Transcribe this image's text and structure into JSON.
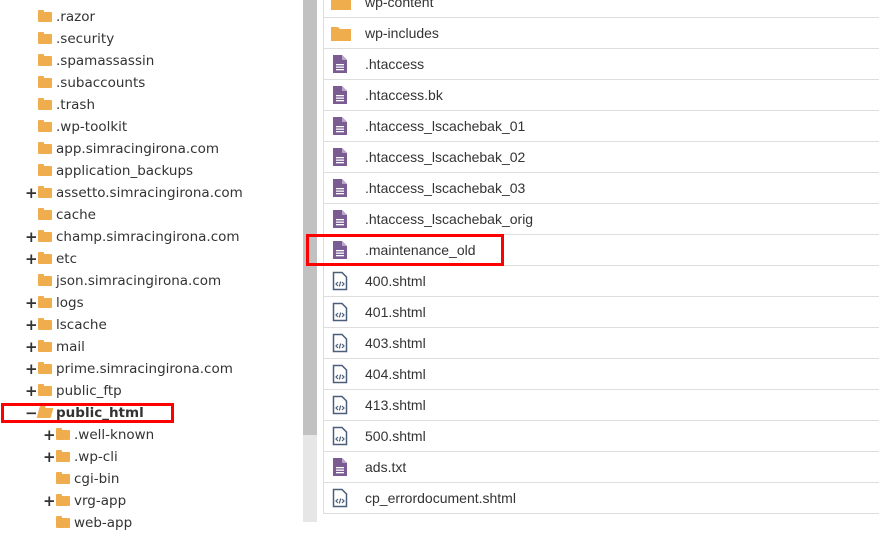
{
  "tree": [
    {
      "label": ".razor",
      "level": 0,
      "toggle": ""
    },
    {
      "label": ".security",
      "level": 0,
      "toggle": ""
    },
    {
      "label": ".spamassassin",
      "level": 0,
      "toggle": ""
    },
    {
      "label": ".subaccounts",
      "level": 0,
      "toggle": ""
    },
    {
      "label": ".trash",
      "level": 0,
      "toggle": ""
    },
    {
      "label": ".wp-toolkit",
      "level": 0,
      "toggle": ""
    },
    {
      "label": "app.simracingirona.com",
      "level": 0,
      "toggle": ""
    },
    {
      "label": "application_backups",
      "level": 0,
      "toggle": ""
    },
    {
      "label": "assetto.simracingirona.com",
      "level": 0,
      "toggle": "+"
    },
    {
      "label": "cache",
      "level": 0,
      "toggle": ""
    },
    {
      "label": "champ.simracingirona.com",
      "level": 0,
      "toggle": "+"
    },
    {
      "label": "etc",
      "level": 0,
      "toggle": "+"
    },
    {
      "label": "json.simracingirona.com",
      "level": 0,
      "toggle": ""
    },
    {
      "label": "logs",
      "level": 0,
      "toggle": "+"
    },
    {
      "label": "lscache",
      "level": 0,
      "toggle": "+"
    },
    {
      "label": "mail",
      "level": 0,
      "toggle": "+"
    },
    {
      "label": "prime.simracingirona.com",
      "level": 0,
      "toggle": "+"
    },
    {
      "label": "public_ftp",
      "level": 0,
      "toggle": "+"
    },
    {
      "label": "public_html",
      "level": 0,
      "toggle": "−",
      "open": true,
      "selected": true
    },
    {
      "label": ".well-known",
      "level": 1,
      "toggle": "+"
    },
    {
      "label": ".wp-cli",
      "level": 1,
      "toggle": "+"
    },
    {
      "label": "cgi-bin",
      "level": 1,
      "toggle": ""
    },
    {
      "label": "vrg-app",
      "level": 1,
      "toggle": "+"
    },
    {
      "label": "web-app",
      "level": 1,
      "toggle": ""
    }
  ],
  "files": [
    {
      "name": "wp-content",
      "type": "folder"
    },
    {
      "name": "wp-includes",
      "type": "folder"
    },
    {
      "name": ".htaccess",
      "type": "text"
    },
    {
      "name": ".htaccess.bk",
      "type": "text"
    },
    {
      "name": ".htaccess_lscachebak_01",
      "type": "text"
    },
    {
      "name": ".htaccess_lscachebak_02",
      "type": "text"
    },
    {
      "name": ".htaccess_lscachebak_03",
      "type": "text"
    },
    {
      "name": ".htaccess_lscachebak_orig",
      "type": "text"
    },
    {
      "name": ".maintenance_old",
      "type": "text",
      "highlighted": true
    },
    {
      "name": "400.shtml",
      "type": "code"
    },
    {
      "name": "401.shtml",
      "type": "code"
    },
    {
      "name": "403.shtml",
      "type": "code"
    },
    {
      "name": "404.shtml",
      "type": "code"
    },
    {
      "name": "413.shtml",
      "type": "code"
    },
    {
      "name": "500.shtml",
      "type": "code"
    },
    {
      "name": "ads.txt",
      "type": "text"
    },
    {
      "name": "cp_errordocument.shtml",
      "type": "code"
    }
  ],
  "colors": {
    "folder": "#f0ad4e",
    "text_file": "#7a5c93",
    "code_file": "#4a5e7a",
    "highlight": "#ff0000"
  }
}
